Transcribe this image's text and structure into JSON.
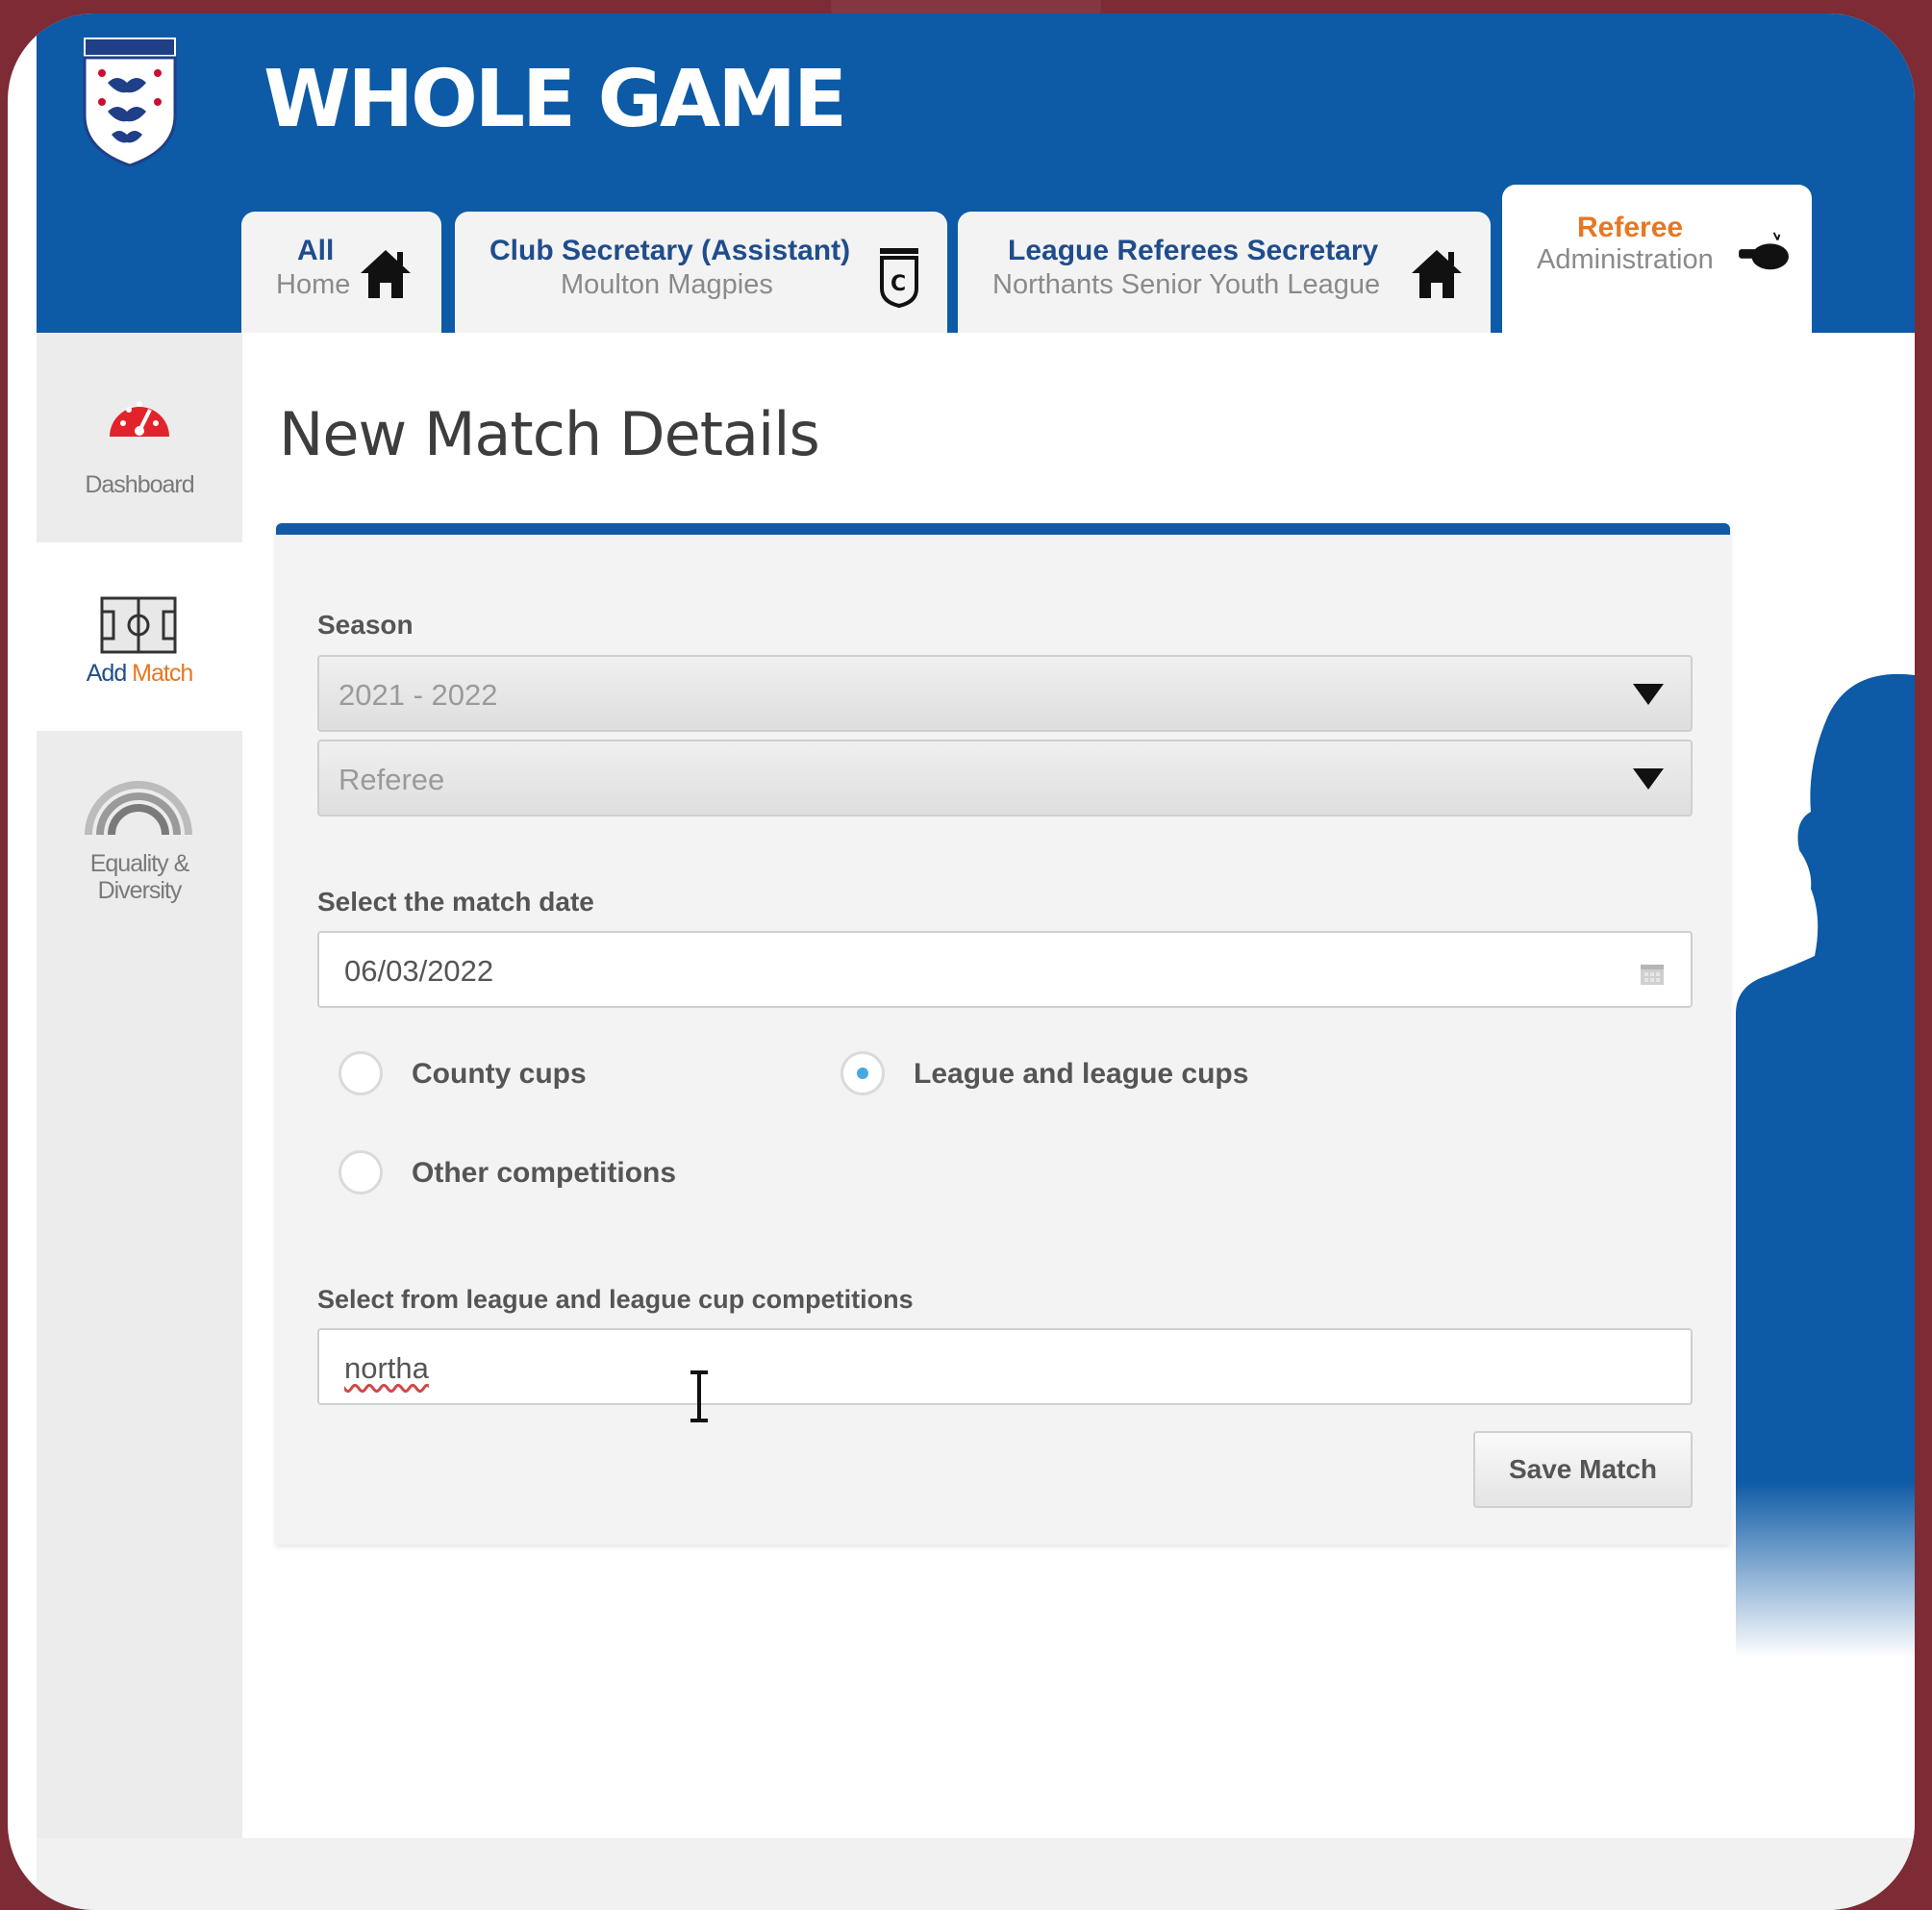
{
  "app": {
    "title": "WHOLE GAME"
  },
  "tabs": [
    {
      "line1": "All",
      "line2": "Home",
      "icon": "home-icon"
    },
    {
      "line1": "Club Secretary (Assistant)",
      "line2": "Moulton Magpies",
      "icon": "club-crest-icon"
    },
    {
      "line1": "League Referees Secretary",
      "line2": "Northants Senior Youth League",
      "icon": "home-icon"
    },
    {
      "line1": "Referee",
      "line2": "Administration",
      "icon": "whistle-icon",
      "active": true
    }
  ],
  "sidebar": {
    "items": [
      {
        "label": "Dashboard",
        "icon": "dashboard-gauge-icon"
      },
      {
        "label_part1": "Add ",
        "label_part2": "Match",
        "icon": "pitch-icon",
        "active": true
      },
      {
        "label_line1": "Equality &",
        "label_line2": "Diversity",
        "icon": "rainbow-icon"
      }
    ]
  },
  "page": {
    "title": "New Match Details"
  },
  "form": {
    "season_label": "Season",
    "season_value": "2021 - 2022",
    "role_value": "Referee",
    "date_label": "Select the match date",
    "date_value": "06/03/2022",
    "radios": [
      {
        "label": "County cups",
        "checked": false
      },
      {
        "label": "League and league cups",
        "checked": true
      },
      {
        "label": "Other competitions",
        "checked": false
      }
    ],
    "competition_label": "Select from league and league cup competitions",
    "competition_value": "northa",
    "save_label": "Save Match"
  },
  "colors": {
    "header_blue": "#0d5aa6",
    "accent_orange": "#e87722",
    "badge_red": "#e3232c"
  }
}
